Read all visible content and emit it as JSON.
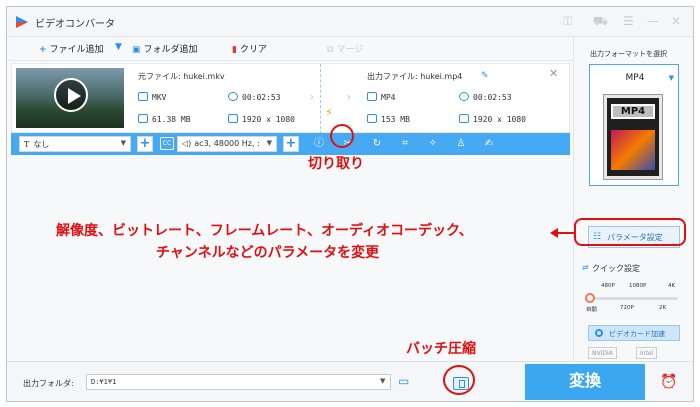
{
  "app": {
    "title": "ビデオコンバータ",
    "icons": [
      "key-icon",
      "cart-icon",
      "menu-icon",
      "minimize-icon",
      "close-icon"
    ]
  },
  "toolbar": {
    "add_file": "ファイル追加",
    "add_folder": "フォルダ追加",
    "clear": "クリア",
    "merge": "マージ"
  },
  "file": {
    "source_label": "元ファイル: hukei.mkv",
    "output_label": "出力ファイル: hukei.mp4",
    "source": {
      "format": "MKV",
      "duration": "00:02:53",
      "size": "61.38 MB",
      "resolution": "1920 x 1080"
    },
    "output": {
      "format": "MP4",
      "duration": "00:02:53",
      "size": "153 MB",
      "resolution": "1920 x 1080"
    }
  },
  "options": {
    "subtitle": "なし",
    "audio": "ac3, 48000 Hz, :",
    "cc": "CC"
  },
  "right_panel": {
    "title": "出力フォーマットを選択",
    "format": "MP4",
    "format_art_label": "MP4",
    "param_button": "パラメータ設定",
    "quick_label": "クイック設定",
    "quick_ticks_top": [
      "480P",
      "1080P",
      "4K"
    ],
    "quick_ticks_bottom": [
      "自動",
      "720P",
      "2K"
    ],
    "quick_value": "自動",
    "gpu_label": "ビデオカード加速",
    "chips": [
      "NVIDIA",
      "Intel"
    ]
  },
  "footer": {
    "output_folder_label": "出力フォルダ:",
    "output_path": "D:¥1¥1",
    "convert_label": "変換"
  },
  "annotations": {
    "cut": "切り取り",
    "params_line1": "解像度、ビットレート、フレームレート、オーディオコーデック、",
    "params_line2": "チャンネルなどのパラメータを変更",
    "batch": "バッチ圧縮",
    "color": "#e01010"
  }
}
